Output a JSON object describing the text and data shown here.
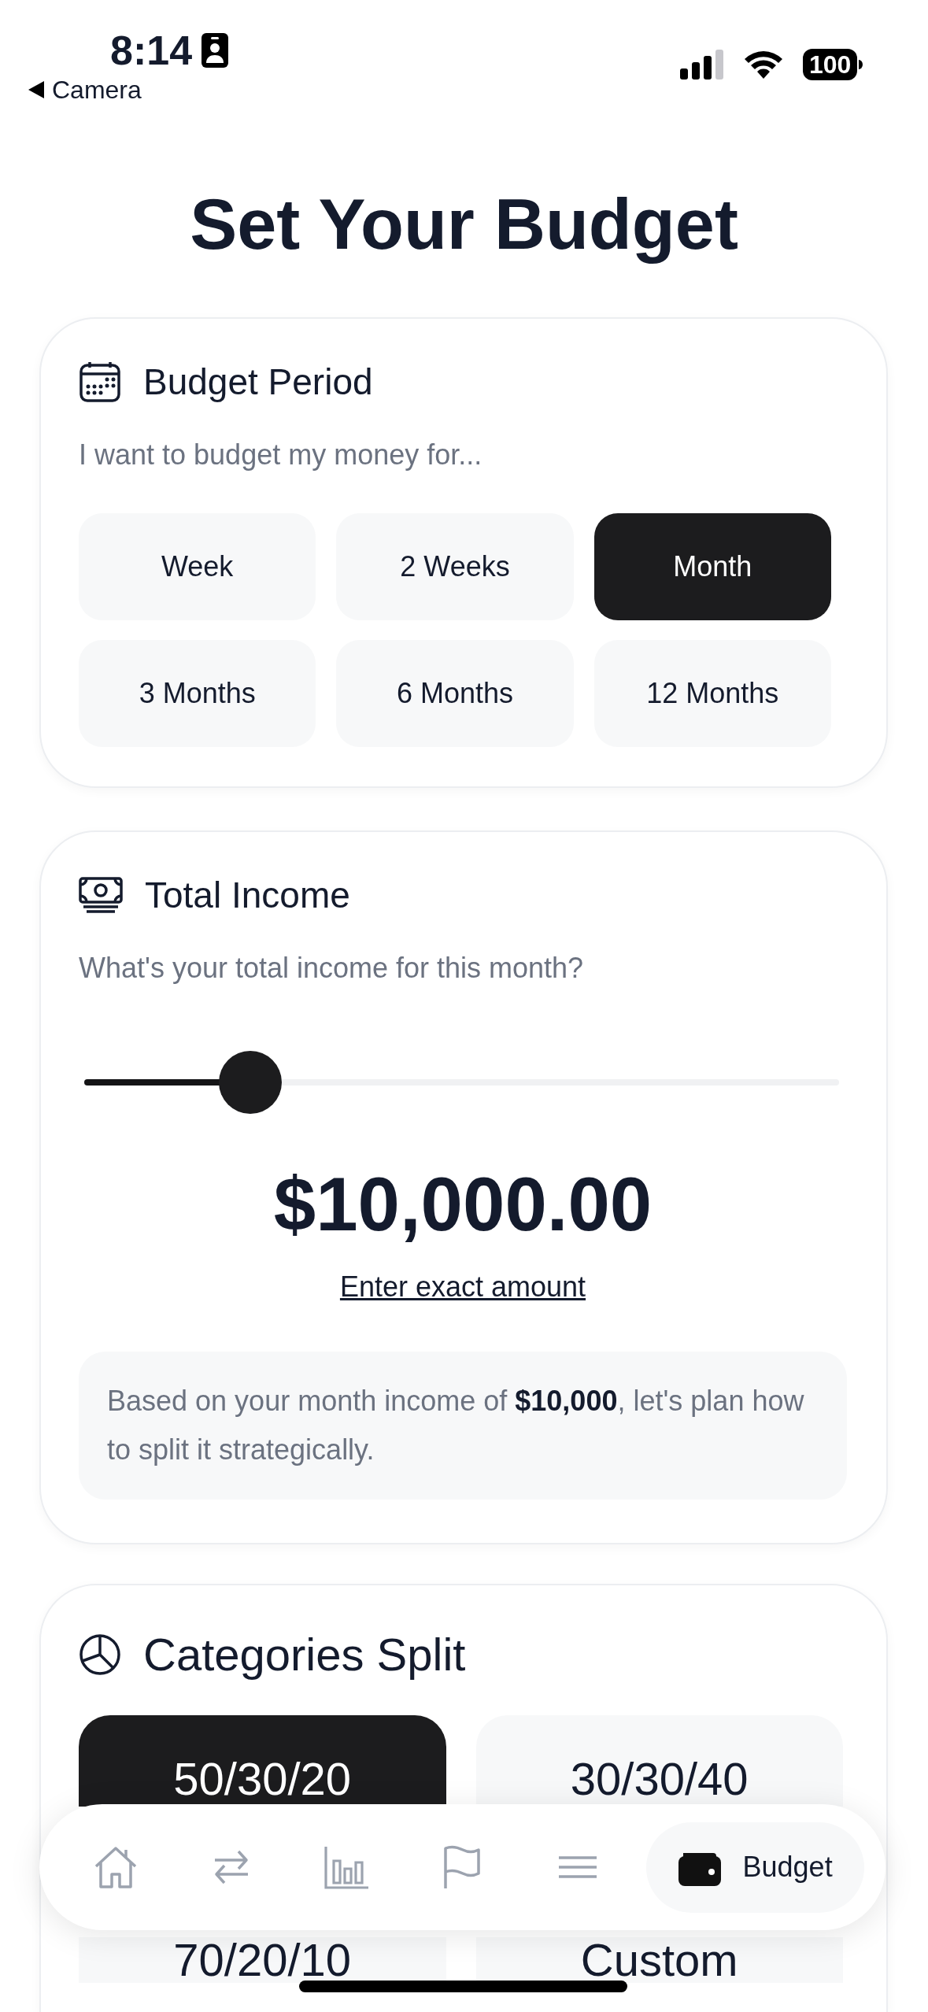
{
  "status_bar": {
    "time": "8:14",
    "back_label": "Camera",
    "battery": "100"
  },
  "title": "Set Your Budget",
  "period_card": {
    "title": "Budget Period",
    "prompt": "I want to budget my money for...",
    "options": [
      {
        "label": "Week",
        "selected": false
      },
      {
        "label": "2 Weeks",
        "selected": false
      },
      {
        "label": "Month",
        "selected": true
      },
      {
        "label": "3 Months",
        "selected": false
      },
      {
        "label": "6 Months",
        "selected": false
      },
      {
        "label": "12 Months",
        "selected": false
      }
    ]
  },
  "income_card": {
    "title": "Total Income",
    "prompt": "What's your total income for this month?",
    "slider": {
      "level": 0.22
    },
    "amount": "$10,000.00",
    "link": "Enter exact amount",
    "note": "Based on your month income of **$10,000**, let's plan how to split it strategically."
  },
  "split_card": {
    "title": "Categories Split",
    "options": [
      {
        "label": "50/30/20",
        "selected": true
      },
      {
        "label": "30/30/40",
        "selected": false
      },
      {
        "label": "70/20/10",
        "selected": false
      },
      {
        "label": "Custom",
        "selected": false
      }
    ]
  },
  "tab_bar": {
    "tabs": [
      {
        "kind": "home",
        "selected": false
      },
      {
        "kind": "transfer",
        "selected": false
      },
      {
        "kind": "chart",
        "selected": false
      },
      {
        "kind": "flag",
        "selected": false
      },
      {
        "kind": "menu",
        "selected": false
      },
      {
        "kind": "wallet",
        "label": "Budget",
        "selected": true
      }
    ]
  }
}
